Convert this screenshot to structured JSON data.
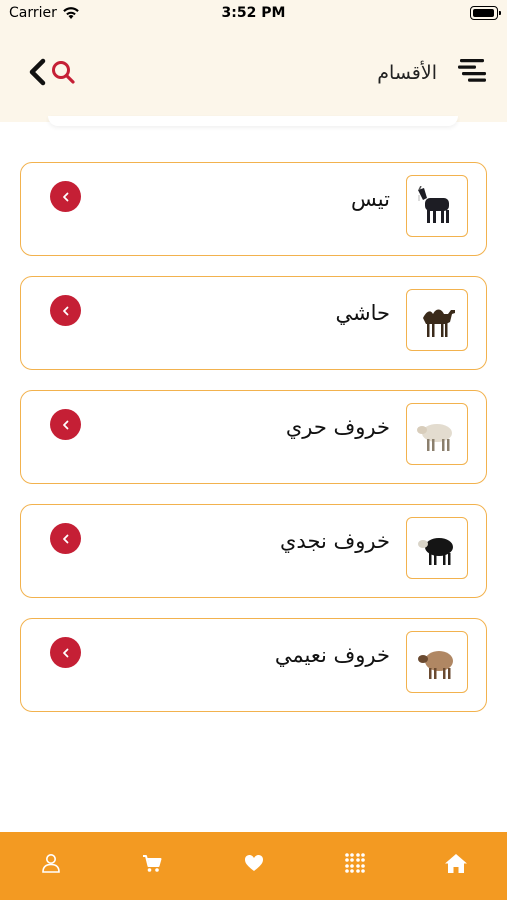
{
  "status_bar": {
    "carrier": "Carrier",
    "time": "3:52 PM"
  },
  "header": {
    "title": "الأقسام",
    "left_icons": [
      "back-chevron-icon",
      "search-icon"
    ],
    "right_icon": "menu-icon"
  },
  "categories": [
    {
      "name": "تيس",
      "image": "goat-icon"
    },
    {
      "name": "حاشي",
      "image": "camel-icon"
    },
    {
      "name": "خروف حري",
      "image": "sheep-icon"
    },
    {
      "name": "خروف نجدي",
      "image": "black-sheep-icon"
    },
    {
      "name": "خروف نعيمي",
      "image": "brown-sheep-icon"
    }
  ],
  "tab_bar": {
    "items": [
      "profile-icon",
      "cart-icon",
      "favorites-icon",
      "categories-icon",
      "home-icon"
    ],
    "background": "#f39a22"
  },
  "colors": {
    "accent": "#f2b24e",
    "chevron": "#c51f35",
    "header_bg": "#fcf6ea"
  }
}
